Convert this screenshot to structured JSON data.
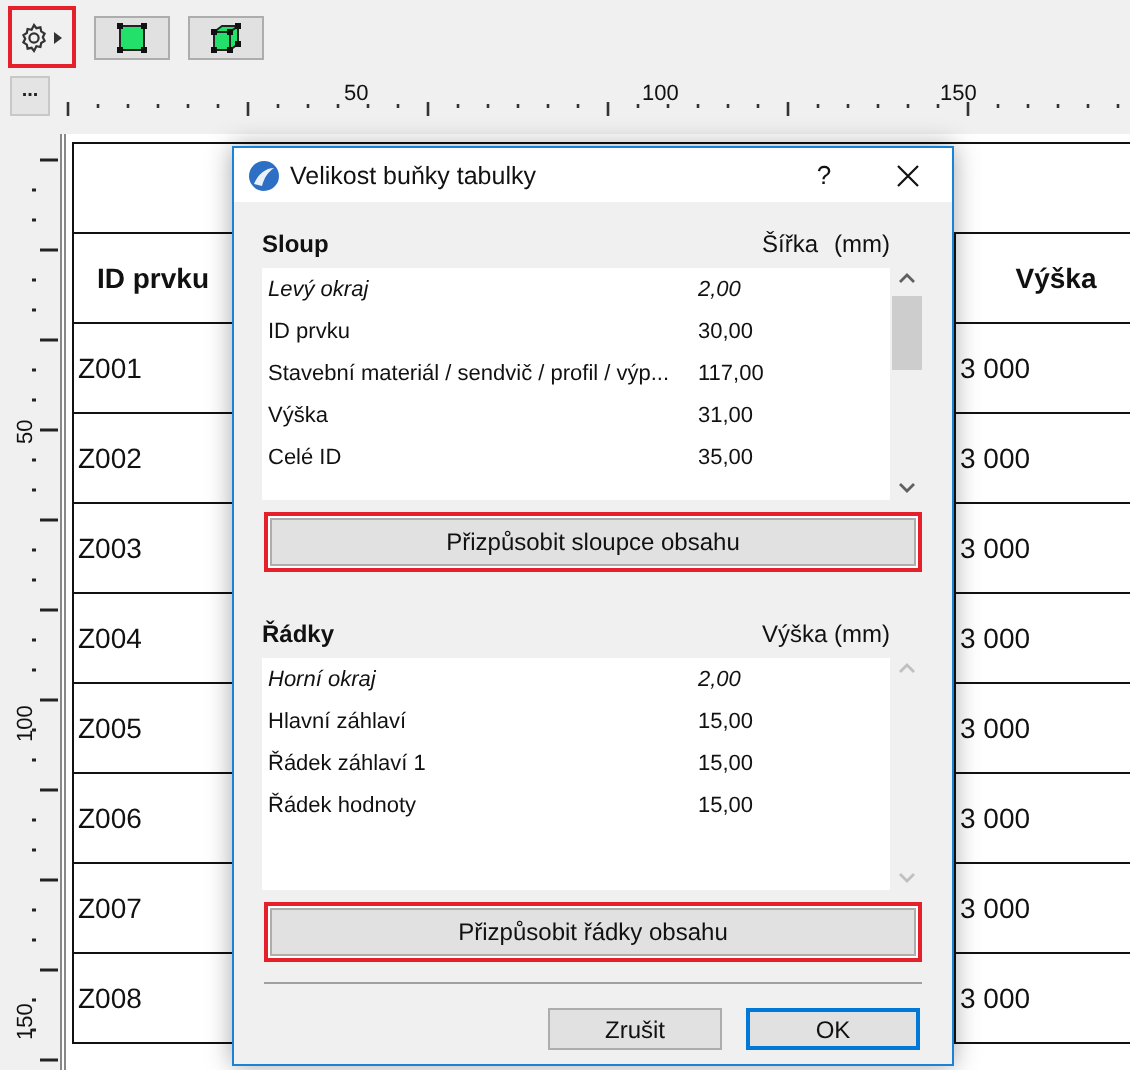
{
  "toolbar": {
    "buttons": [
      {
        "kind": "settings",
        "highlighted": true
      },
      {
        "kind": "plan",
        "highlighted": false
      },
      {
        "kind": "box",
        "highlighted": false
      }
    ]
  },
  "ruler": {
    "button": "...",
    "horizontal_labels": [
      "50",
      "100",
      "150"
    ],
    "vertical_labels": [
      "50",
      "100",
      "150"
    ]
  },
  "table": {
    "columns": [
      "ID prvku",
      "Výška"
    ],
    "rows": [
      [
        "Z001",
        "3 000"
      ],
      [
        "Z002",
        "3 000"
      ],
      [
        "Z003",
        "3 000"
      ],
      [
        "Z004",
        "3 000"
      ],
      [
        "Z005",
        "3 000"
      ],
      [
        "Z006",
        "3 000"
      ],
      [
        "Z007",
        "3 000"
      ],
      [
        "Z008",
        "3 000"
      ]
    ]
  },
  "dialog": {
    "title": "Velikost buňky tabulky",
    "help": "?",
    "sections": [
      {
        "title": "Sloup",
        "value_header": "Šířka",
        "unit": "(mm)",
        "scrollbar_enabled": true,
        "items": [
          {
            "name": "Levý okraj",
            "value": "2,00",
            "italic": true
          },
          {
            "name": "ID prvku",
            "value": "30,00",
            "italic": false
          },
          {
            "name": "Stavební materiál / sendvič / profil / výp...",
            "value": "117,00",
            "italic": false
          },
          {
            "name": "Výška",
            "value": "31,00",
            "italic": false
          },
          {
            "name": "Celé ID",
            "value": "35,00",
            "italic": false
          }
        ],
        "button": {
          "label": "Přizpůsobit sloupce obsahu",
          "highlighted": true
        }
      },
      {
        "title": "Řádky",
        "value_header": "Výška",
        "unit": "(mm)",
        "scrollbar_enabled": false,
        "items": [
          {
            "name": "Horní okraj",
            "value": "2,00",
            "italic": true
          },
          {
            "name": "Hlavní záhlaví",
            "value": "15,00",
            "italic": false
          },
          {
            "name": "Řádek záhlaví 1",
            "value": "15,00",
            "italic": false
          },
          {
            "name": "Řádek hodnoty",
            "value": "15,00",
            "italic": false
          }
        ],
        "button": {
          "label": "Přizpůsobit řádky obsahu",
          "highlighted": true
        }
      }
    ],
    "buttons": [
      {
        "label": "Zrušit",
        "default": false
      },
      {
        "label": "OK",
        "default": true
      }
    ]
  }
}
